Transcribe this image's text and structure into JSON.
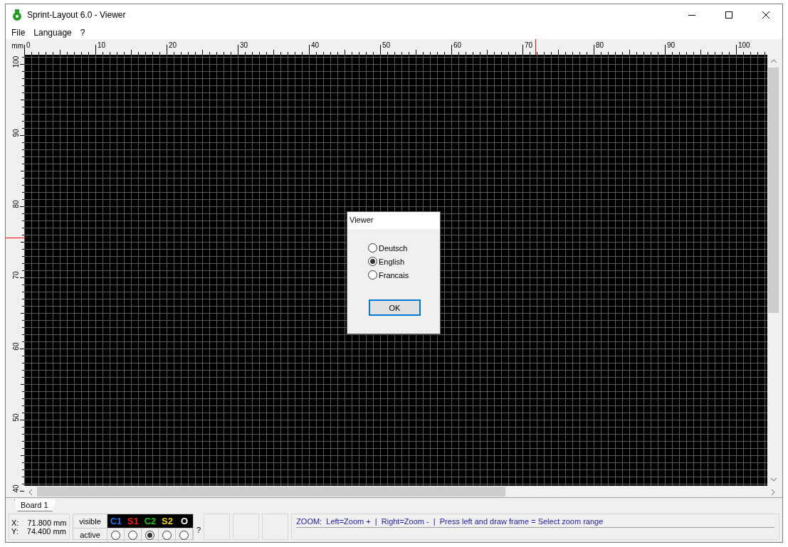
{
  "window": {
    "title": "Sprint-Layout 6.0 - Viewer"
  },
  "menu": [
    {
      "label": "File"
    },
    {
      "label": "Language"
    },
    {
      "label": "?"
    }
  ],
  "ruler": {
    "unit": "mm",
    "x_labels": [
      "0",
      "10",
      "20",
      "30",
      "40",
      "50",
      "60",
      "70",
      "80",
      "90",
      "100"
    ],
    "y_labels": [
      "100",
      "90",
      "80",
      "70",
      "60",
      "50",
      "40"
    ]
  },
  "dialog": {
    "title": "Viewer",
    "options": [
      {
        "label": "Deutsch",
        "selected": false
      },
      {
        "label": "English",
        "selected": true
      },
      {
        "label": "Francais",
        "selected": false
      }
    ],
    "button": "OK"
  },
  "tabs": [
    {
      "label": "Board 1",
      "selected": true
    }
  ],
  "status": {
    "x_label": "X:",
    "x_value": "71.800 mm",
    "y_label": "Y:",
    "y_value": "74.400 mm",
    "visible_label": "visible",
    "active_label": "active",
    "layers": [
      {
        "name": "C1",
        "color": "#2a6ff0",
        "selected": false
      },
      {
        "name": "S1",
        "color": "#ff1a1a",
        "selected": false
      },
      {
        "name": "C2",
        "color": "#1fc01f",
        "selected": true
      },
      {
        "name": "S2",
        "color": "#f0d020",
        "selected": false
      },
      {
        "name": "O",
        "color": "#ffffff",
        "selected": false
      }
    ],
    "help": "?",
    "hint": "ZOOM:  Left=Zoom +  |  Right=Zoom -  |  Press left and draw frame = Select zoom range"
  }
}
